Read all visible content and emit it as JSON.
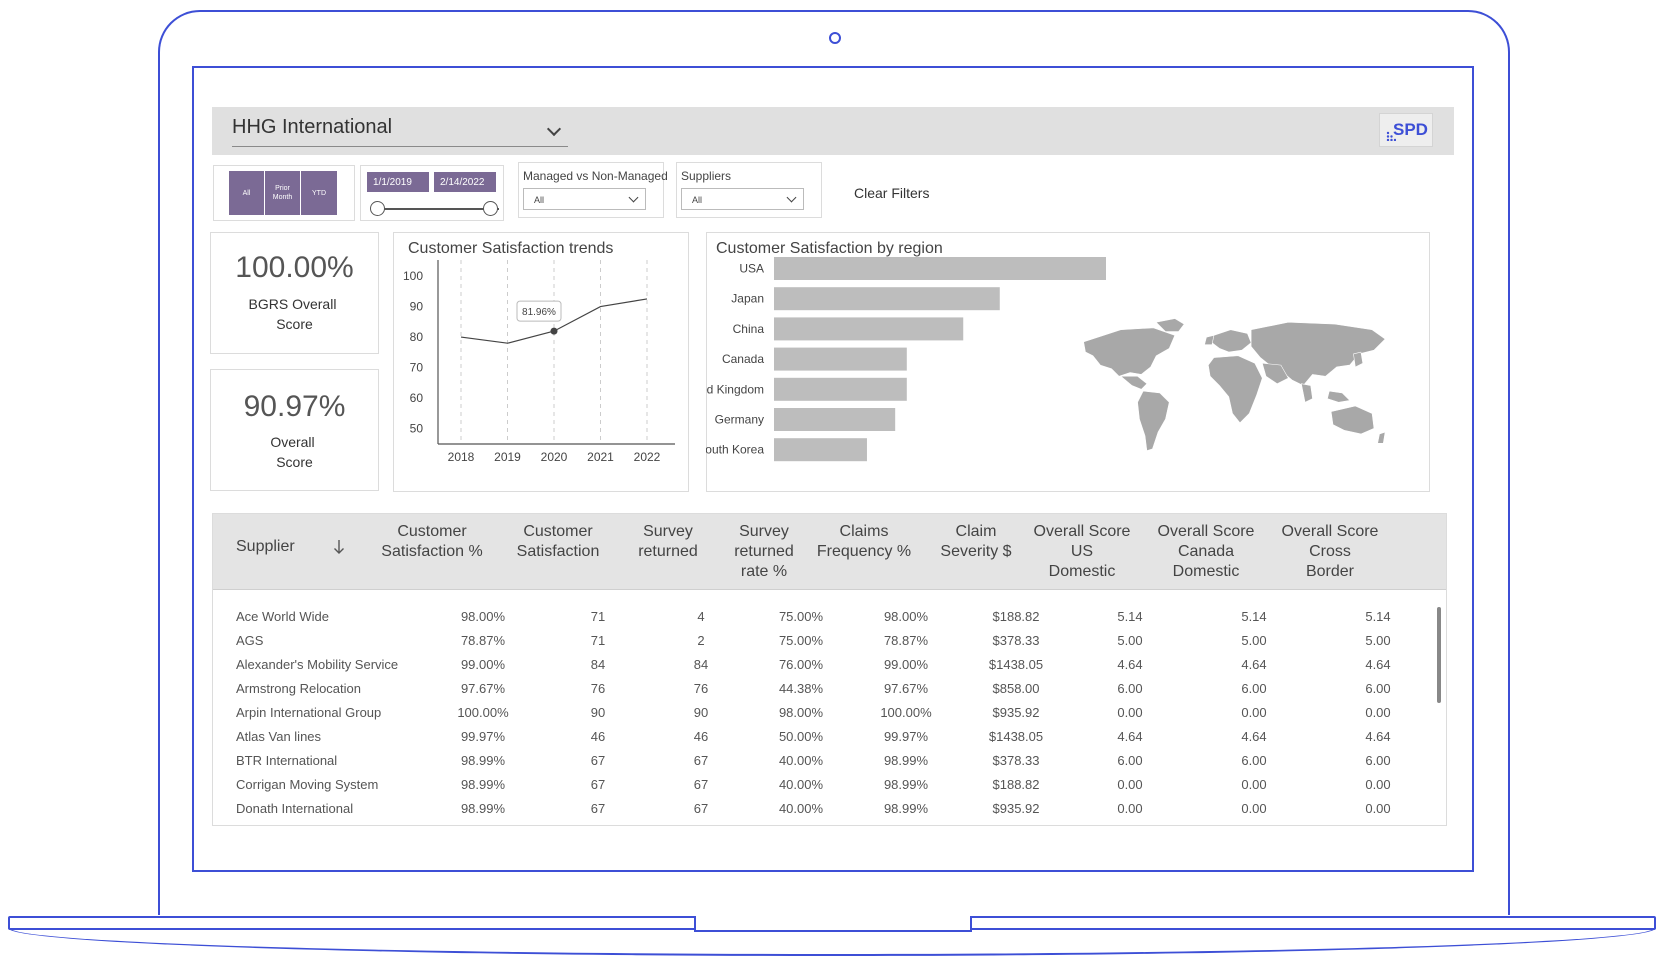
{
  "header": {
    "title": "HHG International",
    "logo_text": "SPD"
  },
  "filters": {
    "period_buttons": [
      {
        "label": "All"
      },
      {
        "label": "Prior Month"
      },
      {
        "label": "YTD"
      }
    ],
    "date_start": "1/1/2019",
    "date_end": "2/14/2022",
    "managed": {
      "label": "Managed vs Non-Managed",
      "value": "All"
    },
    "suppliers": {
      "label": "Suppliers",
      "value": "All"
    },
    "clear_label": "Clear Filters"
  },
  "kpis": [
    {
      "value": "100.00%",
      "label_line1": "BGRS Overall",
      "label_line2": "Score"
    },
    {
      "value": "90.97%",
      "label_line1": "Overall",
      "label_line2": "Score"
    }
  ],
  "charts": {
    "trend_title": "Customer Satisfaction trends",
    "region_title": "Customer Satisfaction by region"
  },
  "chart_data": [
    {
      "type": "line",
      "title": "Customer Satisfaction trends",
      "x": [
        "2018",
        "2019",
        "2020",
        "2021",
        "2022"
      ],
      "y_ticks": [
        100,
        90,
        80,
        70,
        60,
        50
      ],
      "ylim": [
        45,
        100
      ],
      "values": [
        80,
        78,
        81.96,
        90,
        92.5
      ],
      "annotation": {
        "x": "2020",
        "label": "81.96%"
      },
      "grid": "vertical-dashed"
    },
    {
      "type": "bar",
      "orientation": "horizontal",
      "title": "Customer Satisfaction by region",
      "categories": [
        "USA",
        "Japan",
        "China",
        "Canada",
        "United Kingdom",
        "Germany",
        "South Korea"
      ],
      "values": [
        100,
        68,
        57,
        40,
        40,
        36.5,
        28
      ],
      "xlim": [
        0,
        100
      ],
      "color": "#bdbdbd"
    }
  ],
  "table": {
    "headers": [
      {
        "l1": "Supplier",
        "l2": "",
        "l3": ""
      },
      {
        "l1": "Customer",
        "l2": "Satisfaction %",
        "l3": ""
      },
      {
        "l1": "Customer",
        "l2": "Satisfaction",
        "l3": ""
      },
      {
        "l1": "Survey",
        "l2": "returned",
        "l3": ""
      },
      {
        "l1": "Survey",
        "l2": "returned",
        "l3": "rate %"
      },
      {
        "l1": "Claims",
        "l2": "Frequency %",
        "l3": ""
      },
      {
        "l1": "Claim",
        "l2": "Severity $",
        "l3": ""
      },
      {
        "l1": "Overall Score",
        "l2": "US",
        "l3": "Domestic"
      },
      {
        "l1": "Overall Score",
        "l2": "Canada",
        "l3": "Domestic"
      },
      {
        "l1": "Overall Score",
        "l2": "Cross",
        "l3": "Border"
      }
    ],
    "rows": [
      [
        "Ace World Wide",
        "98.00%",
        "71",
        "4",
        "75.00%",
        "98.00%",
        "$188.82",
        "5.14",
        "5.14",
        "5.14"
      ],
      [
        "AGS",
        "78.87%",
        "71",
        "2",
        "75.00%",
        "78.87%",
        "$378.33",
        "5.00",
        "5.00",
        "5.00"
      ],
      [
        "Alexander's Mobility Service",
        "99.00%",
        "84",
        "84",
        "76.00%",
        "99.00%",
        "$1438.05",
        "4.64",
        "4.64",
        "4.64"
      ],
      [
        "Armstrong Relocation",
        "97.67%",
        "76",
        "76",
        "44.38%",
        "97.67%",
        "$858.00",
        "6.00",
        "6.00",
        "6.00"
      ],
      [
        "Arpin International Group",
        "100.00%",
        "90",
        "90",
        "98.00%",
        "100.00%",
        "$935.92",
        "0.00",
        "0.00",
        "0.00"
      ],
      [
        "Atlas Van lines",
        "99.97%",
        "46",
        "46",
        "50.00%",
        "99.97%",
        "$1438.05",
        "4.64",
        "4.64",
        "4.64"
      ],
      [
        "BTR International",
        "98.99%",
        "67",
        "67",
        "40.00%",
        "98.99%",
        "$378.33",
        "6.00",
        "6.00",
        "6.00"
      ],
      [
        "Corrigan Moving System",
        "98.99%",
        "67",
        "67",
        "40.00%",
        "98.99%",
        "$188.82",
        "0.00",
        "0.00",
        "0.00"
      ],
      [
        "Donath International",
        "98.99%",
        "67",
        "67",
        "40.00%",
        "98.99%",
        "$935.92",
        "0.00",
        "0.00",
        "0.00"
      ]
    ]
  }
}
